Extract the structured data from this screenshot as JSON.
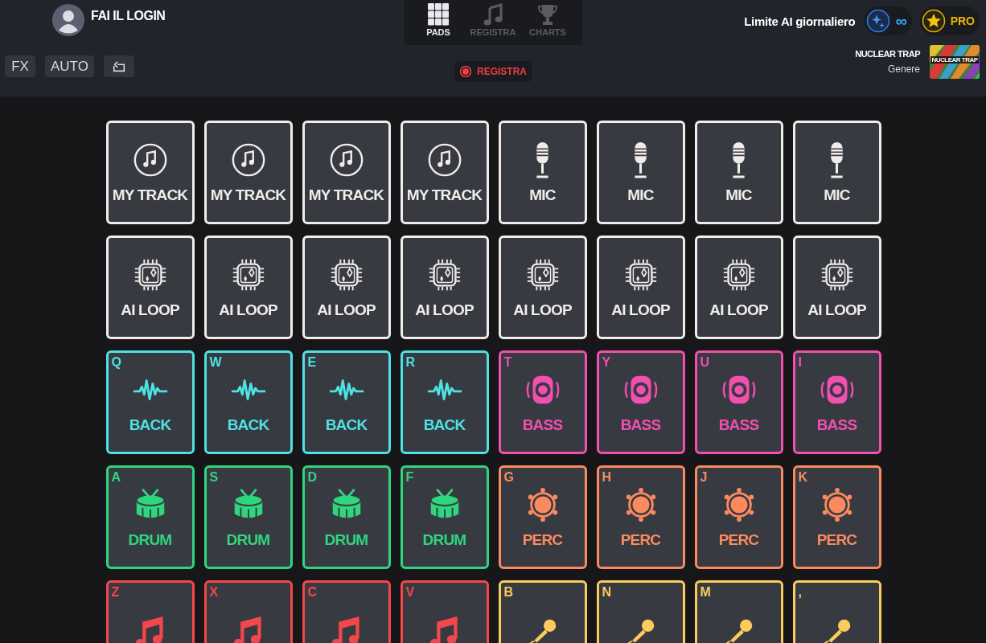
{
  "header": {
    "login_label": "FAI IL LOGIN",
    "tools": [
      {
        "kind": "text",
        "label": "FX"
      },
      {
        "kind": "text",
        "label": "AUTO"
      },
      {
        "kind": "undo"
      }
    ],
    "tabs": [
      {
        "label": "PADS",
        "kind": "pads",
        "selected": true
      },
      {
        "label": "REGISTRA",
        "kind": "record",
        "selected": false
      },
      {
        "label": "CHARTS",
        "kind": "charts",
        "selected": false
      }
    ],
    "record_button": "REGISTRA",
    "ai_limit_label": "Limite AI giornaliero",
    "ai_limit_value": "∞",
    "pro_label": "PRO",
    "genre": {
      "name": "NUCLEAR TRAP",
      "caption": "Genere",
      "thumbnail_label": "NUCLEAR TRAP"
    }
  },
  "pads": [
    {
      "kind": "track",
      "color": "#f0ecea",
      "label": "MY TRACK"
    },
    {
      "kind": "track",
      "color": "#f0ecea",
      "label": "MY TRACK"
    },
    {
      "kind": "track",
      "color": "#f0ecea",
      "label": "MY TRACK"
    },
    {
      "kind": "track",
      "color": "#f0ecea",
      "label": "MY TRACK"
    },
    {
      "kind": "mic",
      "color": "#f0ecea",
      "label": "MIC"
    },
    {
      "kind": "mic",
      "color": "#f0ecea",
      "label": "MIC"
    },
    {
      "kind": "mic",
      "color": "#f0ecea",
      "label": "MIC"
    },
    {
      "kind": "mic",
      "color": "#f0ecea",
      "label": "MIC"
    },
    {
      "kind": "ailoop",
      "color": "#f0ecea",
      "label": "AI LOOP"
    },
    {
      "kind": "ailoop",
      "color": "#f0ecea",
      "label": "AI LOOP"
    },
    {
      "kind": "ailoop",
      "color": "#f0ecea",
      "label": "AI LOOP"
    },
    {
      "kind": "ailoop",
      "color": "#f0ecea",
      "label": "AI LOOP"
    },
    {
      "kind": "ailoop",
      "color": "#f0ecea",
      "label": "AI LOOP"
    },
    {
      "kind": "ailoop",
      "color": "#f0ecea",
      "label": "AI LOOP"
    },
    {
      "kind": "ailoop",
      "color": "#f0ecea",
      "label": "AI LOOP"
    },
    {
      "kind": "ailoop",
      "color": "#f0ecea",
      "label": "AI LOOP"
    },
    {
      "kind": "wave",
      "color": "#4de3e3",
      "key": "Q",
      "label": "BACK"
    },
    {
      "kind": "wave",
      "color": "#4de3e3",
      "key": "W",
      "label": "BACK"
    },
    {
      "kind": "wave",
      "color": "#4de3e3",
      "key": "E",
      "label": "BACK"
    },
    {
      "kind": "wave",
      "color": "#4de3e3",
      "key": "R",
      "label": "BACK"
    },
    {
      "kind": "speaker",
      "color": "#f34fb0",
      "key": "T",
      "label": "BASS"
    },
    {
      "kind": "speaker",
      "color": "#f34fb0",
      "key": "Y",
      "label": "BASS"
    },
    {
      "kind": "speaker",
      "color": "#f34fb0",
      "key": "U",
      "label": "BASS"
    },
    {
      "kind": "speaker",
      "color": "#f34fb0",
      "key": "I",
      "label": "BASS"
    },
    {
      "kind": "drum",
      "color": "#2fd67f",
      "key": "A",
      "label": "DRUM"
    },
    {
      "kind": "drum",
      "color": "#2fd67f",
      "key": "S",
      "label": "DRUM"
    },
    {
      "kind": "drum",
      "color": "#2fd67f",
      "key": "D",
      "label": "DRUM"
    },
    {
      "kind": "drum",
      "color": "#2fd67f",
      "key": "F",
      "label": "DRUM"
    },
    {
      "kind": "perc",
      "color": "#fb8a5e",
      "key": "G",
      "label": "PERC"
    },
    {
      "kind": "perc",
      "color": "#fb8a5e",
      "key": "H",
      "label": "PERC"
    },
    {
      "kind": "perc",
      "color": "#fb8a5e",
      "key": "J",
      "label": "PERC"
    },
    {
      "kind": "perc",
      "color": "#fb8a5e",
      "key": "K",
      "label": "PERC"
    },
    {
      "kind": "note",
      "color": "#f4474a",
      "key": "Z"
    },
    {
      "kind": "note",
      "color": "#f4474a",
      "key": "X"
    },
    {
      "kind": "note",
      "color": "#f4474a",
      "key": "C"
    },
    {
      "kind": "note",
      "color": "#f4474a",
      "key": "V"
    },
    {
      "kind": "singer",
      "color": "#fbcb5c",
      "key": "B"
    },
    {
      "kind": "singer",
      "color": "#fbcb5c",
      "key": "N"
    },
    {
      "kind": "singer",
      "color": "#fbcb5c",
      "key": "M"
    },
    {
      "kind": "singer",
      "color": "#fbcb5c",
      "key": ","
    }
  ]
}
